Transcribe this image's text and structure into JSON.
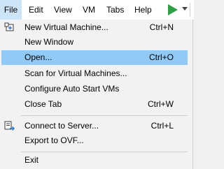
{
  "menubar": {
    "items": [
      {
        "label": "File"
      },
      {
        "label": "Edit"
      },
      {
        "label": "View"
      },
      {
        "label": "VM"
      },
      {
        "label": "Tabs"
      },
      {
        "label": "Help"
      }
    ],
    "toolbar_icons": [
      "play-icon",
      "dropdown-caret-icon"
    ],
    "accent_color": "#2ea043"
  },
  "menu": {
    "highlight_color": "#91c9f7",
    "items": [
      {
        "label": "New Virtual Machine...",
        "shortcut": "Ctrl+N",
        "icon": "new-vm-icon"
      },
      {
        "label": "New Window",
        "shortcut": ""
      },
      {
        "label": "Open...",
        "shortcut": "Ctrl+O",
        "highlighted": true
      },
      {
        "label": "Scan for Virtual Machines...",
        "shortcut": ""
      },
      {
        "label": "Configure Auto Start VMs",
        "shortcut": ""
      },
      {
        "label": "Close Tab",
        "shortcut": "Ctrl+W"
      },
      {
        "label": "Connect to Server...",
        "shortcut": "Ctrl+L",
        "icon": "connect-server-icon"
      },
      {
        "label": "Export to OVF...",
        "shortcut": ""
      },
      {
        "label": "Exit",
        "shortcut": ""
      }
    ]
  }
}
